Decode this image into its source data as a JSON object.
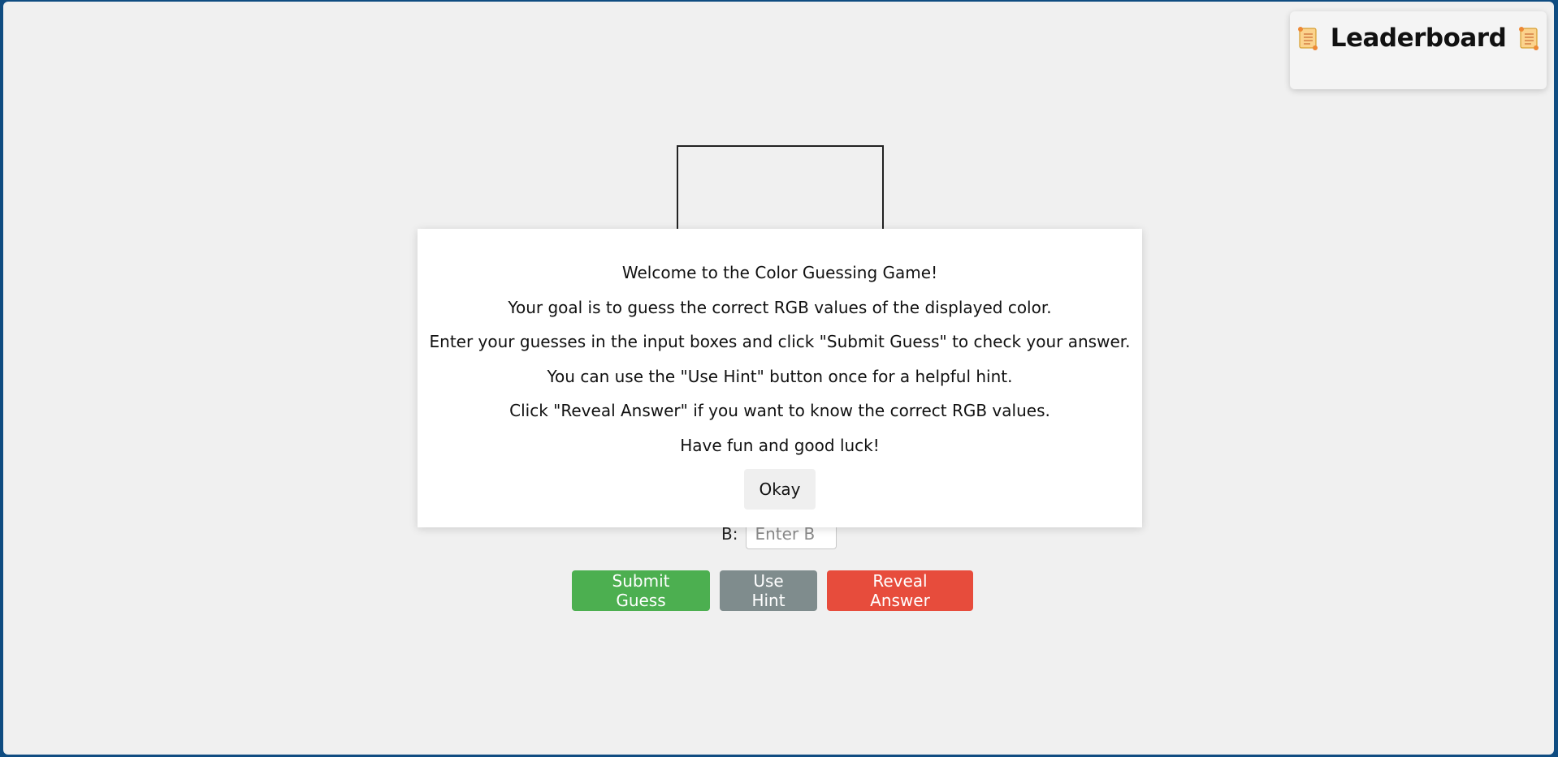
{
  "leaderboard": {
    "title": "Leaderboard",
    "icon_left": "scroll-icon",
    "icon_right": "scroll-icon"
  },
  "inputs": {
    "b_label": "B:",
    "b_placeholder": "Enter B"
  },
  "actions": {
    "submit_label": "Submit Guess",
    "hint_label": "Use Hint",
    "reveal_label": "Reveal Answer"
  },
  "modal": {
    "lines": [
      "Welcome to the Color Guessing Game!",
      "Your goal is to guess the correct RGB values of the displayed color.",
      "Enter your guesses in the input boxes and click \"Submit Guess\" to check your answer.",
      "You can use the \"Use Hint\" button once for a helpful hint.",
      "Click \"Reveal Answer\" if you want to know the correct RGB values.",
      "Have fun and good luck!"
    ],
    "okay_label": "Okay"
  },
  "colors": {
    "submit": "#4caf50",
    "hint": "#7f8c8d",
    "reveal": "#e74c3c",
    "background": "#f0f0f0",
    "frame": "#0f4c81"
  }
}
